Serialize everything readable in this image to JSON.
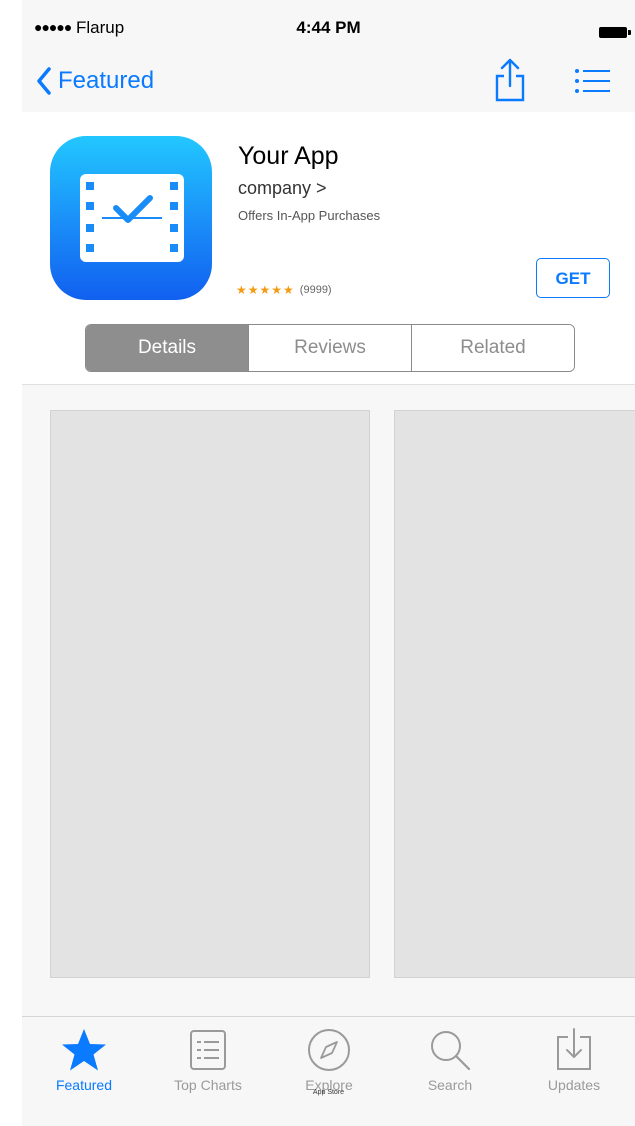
{
  "status": {
    "carrier": "Flarup",
    "time": "4:44 PM"
  },
  "nav": {
    "back_label": "Featured"
  },
  "app": {
    "name": "Your App",
    "company": "company >",
    "offers": "Offers In-App Purchases",
    "stars": "★★★★★",
    "rating_count": "(9999)",
    "get_label": "GET"
  },
  "segments": [
    {
      "label": "Details",
      "active": true
    },
    {
      "label": "Reviews",
      "active": false
    },
    {
      "label": "Related",
      "active": false
    }
  ],
  "tabs": [
    {
      "label": "Featured",
      "icon": "star-icon",
      "active": true
    },
    {
      "label": "Top Charts",
      "icon": "list-icon",
      "active": false
    },
    {
      "label": "Explore",
      "icon": "compass-icon",
      "active": false
    },
    {
      "label": "Search",
      "icon": "search-icon",
      "active": false
    },
    {
      "label": "Updates",
      "icon": "download-icon",
      "active": false
    }
  ],
  "footer": {
    "note": "App Store"
  },
  "colors": {
    "accent": "#0a7aff",
    "star": "#f39c12",
    "placeholder": "#e3e3e3"
  }
}
